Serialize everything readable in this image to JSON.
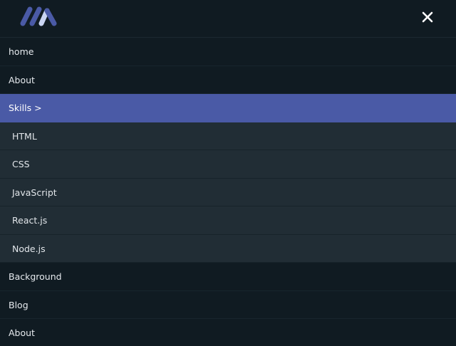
{
  "header": {
    "logo_icon": "brand-logo-icon",
    "close_icon": "close-icon",
    "accent_color": "#4a5aa6"
  },
  "menu": {
    "items": [
      {
        "label": "home"
      },
      {
        "label": "About"
      },
      {
        "label": "Skills >",
        "active": true
      },
      {
        "label": "Background"
      },
      {
        "label": "Blog"
      },
      {
        "label": "About"
      }
    ],
    "skills_submenu": [
      {
        "label": "HTML"
      },
      {
        "label": "CSS"
      },
      {
        "label": "JavaScript"
      },
      {
        "label": "React.js"
      },
      {
        "label": "Node.js"
      }
    ]
  }
}
